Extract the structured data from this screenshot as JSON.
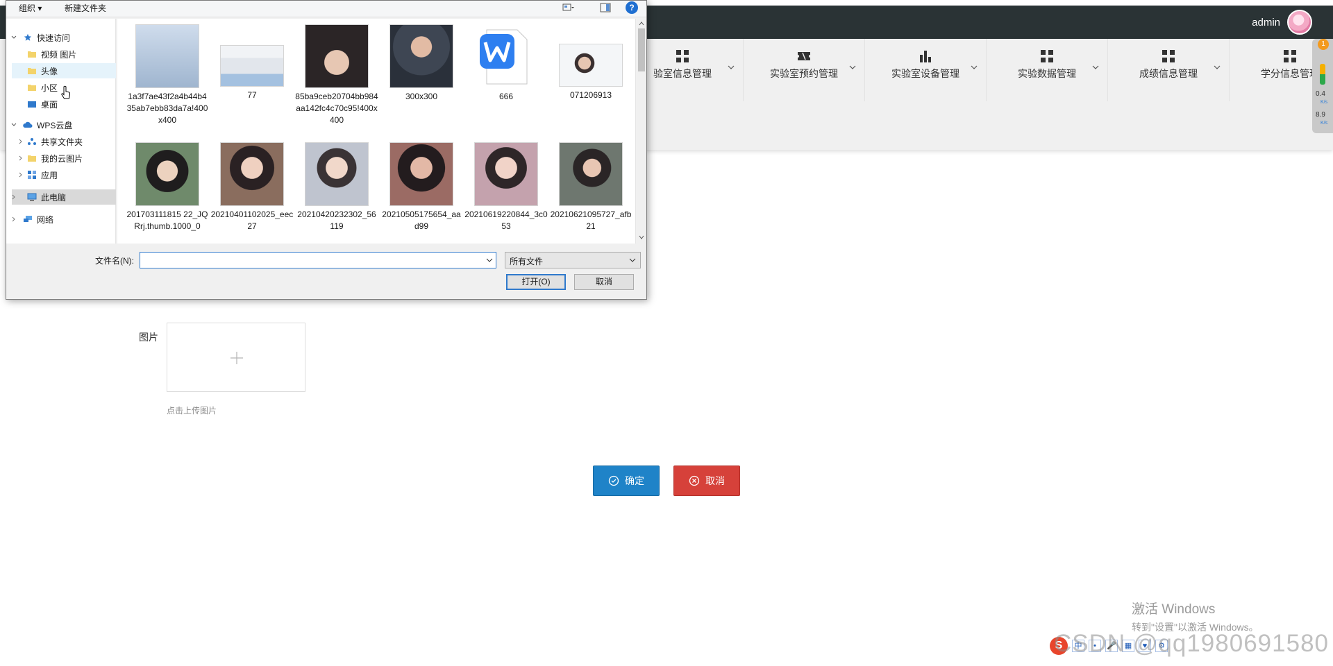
{
  "app": {
    "username": "admin",
    "nav": [
      {
        "label": "验室信息管理",
        "icon": "grid-icon"
      },
      {
        "label": "实验室预约管理",
        "icon": "ticket-icon"
      },
      {
        "label": "实验室设备管理",
        "icon": "bar-chart-icon"
      },
      {
        "label": "实验数据管理",
        "icon": "grid-icon"
      },
      {
        "label": "成绩信息管理",
        "icon": "grid-icon"
      },
      {
        "label": "学分信息管理",
        "icon": "grid-icon"
      }
    ],
    "side_widget": {
      "badge": "1",
      "val1": "0.4",
      "unit1": "K/s",
      "val2": "8.9",
      "unit2": "K/s"
    },
    "form": {
      "image_label": "图片",
      "upload_hint": "点击上传图片",
      "ok_label": "确定",
      "cancel_label": "取消"
    }
  },
  "dialog": {
    "toolbar": {
      "organize": "组织 ▾",
      "new_folder": "新建文件夹",
      "help": "?"
    },
    "tree": {
      "quick_access": "快速访问",
      "videos_pictures": "视频 图片",
      "avatar": "头像",
      "community": "小区",
      "desktop": "桌面",
      "wps_cloud": "WPS云盘",
      "shared_folder": "共享文件夹",
      "my_cloud_pictures": "我的云图片",
      "apps": "应用",
      "this_pc": "此电脑",
      "network": "网络"
    },
    "files": [
      {
        "name": "1a3f7ae43f2a4b44b435ab7ebb83da7a!400x400",
        "color": "#b7c9df"
      },
      {
        "name": "77",
        "color": "#e4e8ee"
      },
      {
        "name": "85ba9ceb20704bb984aa142fc4c70c95!400x400",
        "color": "#3f3a3c"
      },
      {
        "name": "300x300",
        "color": "#5b6472"
      },
      {
        "name": "666",
        "color": "#ffffff"
      },
      {
        "name": "071206913",
        "color": "#e9eef3"
      },
      {
        "name": "201703111815 22_JQRrj.thumb.1000_0",
        "color": "#7f8f7a"
      },
      {
        "name": "20210401102025_eec27",
        "color": "#8b6f5e"
      },
      {
        "name": "20210420232302_56119",
        "color": "#c9c3c6"
      },
      {
        "name": "20210505175654_aad99",
        "color": "#6e4a4c"
      },
      {
        "name": "20210619220844_3c053",
        "color": "#b89aa3"
      },
      {
        "name": "20210621095727_afb21",
        "color": "#5e6660"
      }
    ],
    "filename_label": "文件名(N):",
    "filename_value": "",
    "filter": "所有文件",
    "open_label": "打开(O)",
    "cancel_label": "取消"
  },
  "system": {
    "activation_title": "激活 Windows",
    "activation_sub": "转到\"设置\"以激活 Windows。",
    "csdn": "CSDN @qq1980691580",
    "ime": [
      "中",
      "•",
      "🎤",
      "▦",
      "♥",
      "⚙"
    ]
  }
}
